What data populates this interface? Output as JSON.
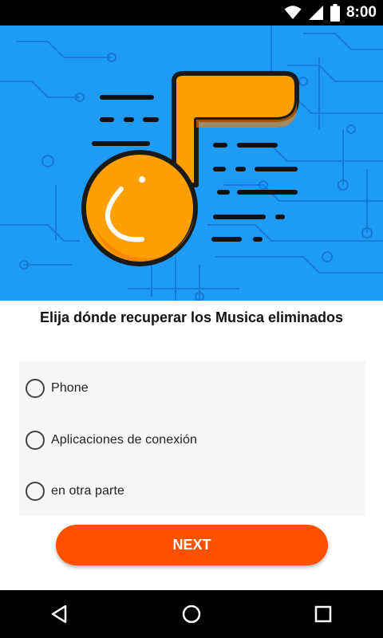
{
  "status_bar": {
    "time": "8:00",
    "icons": [
      "wifi-icon",
      "cellular-icon",
      "battery-icon"
    ]
  },
  "hero": {
    "icon": "music-note-icon",
    "background_color": "#2196F3",
    "note_color": "#FFA000"
  },
  "question": {
    "text": "Elija dónde recuperar los Musica eliminados"
  },
  "options": [
    {
      "label": "Phone",
      "selected": false
    },
    {
      "label": "Aplicaciones de conexión",
      "selected": false
    },
    {
      "label": "en otra parte",
      "selected": false
    }
  ],
  "next_button": {
    "label": "NEXT",
    "color": "#FF5100"
  },
  "nav_bar": {
    "icons": [
      "back-icon",
      "home-icon",
      "recents-icon"
    ]
  }
}
